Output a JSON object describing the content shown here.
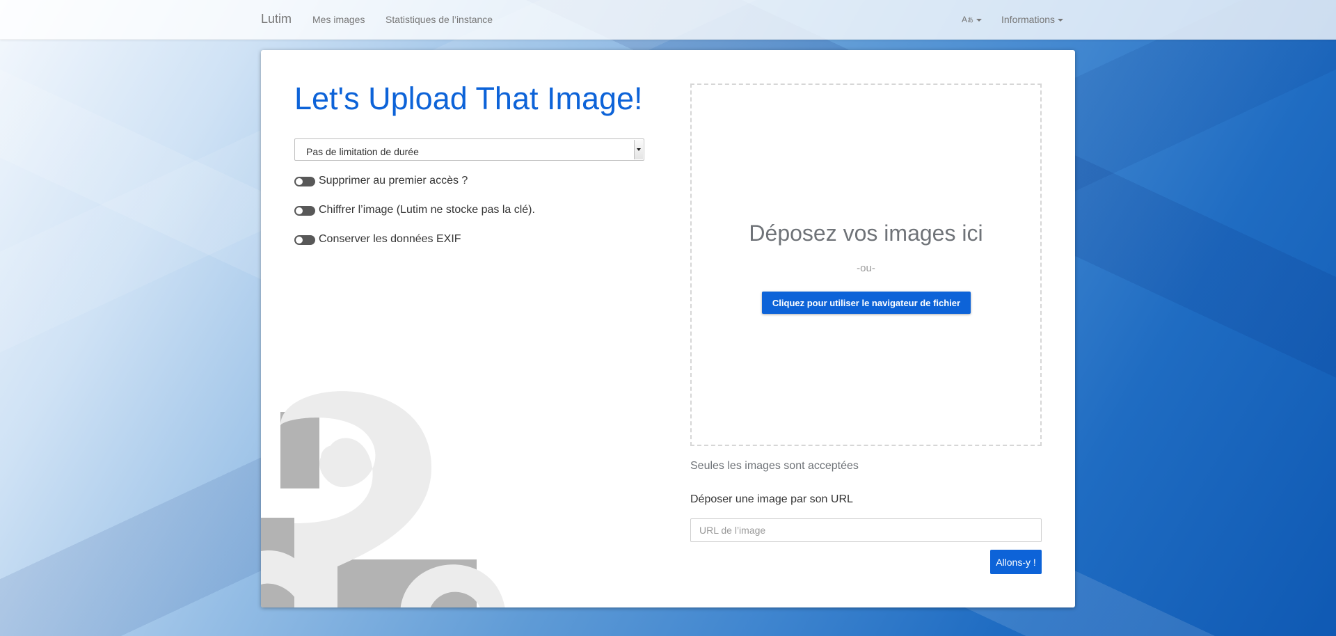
{
  "navbar": {
    "brand": "Lutim",
    "links": [
      "Mes images",
      "Statistiques de l’instance"
    ],
    "lang_label": "A",
    "info_label": "Informations"
  },
  "form": {
    "title": "Let's Upload That Image!",
    "duration_select": "Pas de limitation de durée",
    "options": [
      "Supprimer au premier accès ?",
      "Chiffrer l’image (Lutim ne stocke pas la clé).",
      "Conserver les données EXIF"
    ]
  },
  "dropzone": {
    "title": "Déposez vos images ici",
    "or": "-ou-",
    "browse_label": "Cliquez pour utiliser le navigateur de fichier"
  },
  "note": "Seules les images sont acceptées",
  "url_upload": {
    "label": "Déposer une image par son URL",
    "placeholder": "URL de l’image",
    "submit_label": "Allons-y !"
  }
}
